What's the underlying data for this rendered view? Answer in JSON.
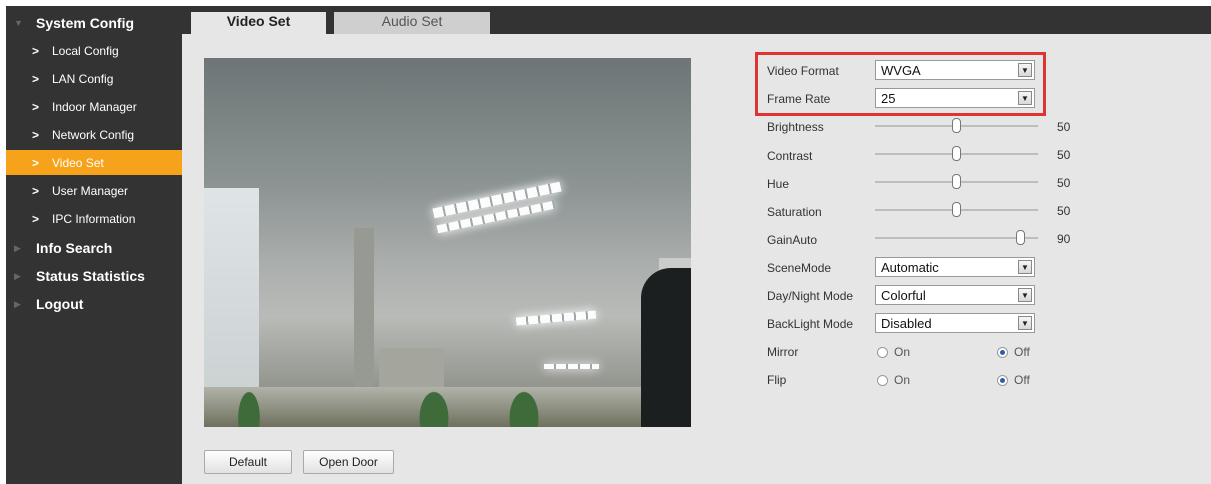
{
  "sidebar": {
    "sections": [
      {
        "label": "System Config"
      },
      {
        "label": "Info Search"
      },
      {
        "label": "Status Statistics"
      },
      {
        "label": "Logout"
      }
    ],
    "items": [
      {
        "label": "Local Config"
      },
      {
        "label": "LAN Config"
      },
      {
        "label": "Indoor Manager"
      },
      {
        "label": "Network Config"
      },
      {
        "label": "Video Set",
        "active": true
      },
      {
        "label": "User Manager"
      },
      {
        "label": "IPC Information"
      }
    ]
  },
  "tabs": [
    {
      "label": "Video Set",
      "active": true
    },
    {
      "label": "Audio Set",
      "active": false
    }
  ],
  "settings": {
    "video_format": {
      "label": "Video Format",
      "value": "WVGA"
    },
    "frame_rate": {
      "label": "Frame Rate",
      "value": "25"
    },
    "brightness": {
      "label": "Brightness",
      "value": "50"
    },
    "contrast": {
      "label": "Contrast",
      "value": "50"
    },
    "hue": {
      "label": "Hue",
      "value": "50"
    },
    "saturation": {
      "label": "Saturation",
      "value": "50"
    },
    "gain_auto": {
      "label": "GainAuto",
      "value": "90"
    },
    "scene_mode": {
      "label": "SceneMode",
      "value": "Automatic"
    },
    "day_night_mode": {
      "label": "Day/Night Mode",
      "value": "Colorful"
    },
    "backlight_mode": {
      "label": "BackLight Mode",
      "value": "Disabled"
    },
    "mirror": {
      "label": "Mirror",
      "on_label": "On",
      "off_label": "Off",
      "selected": "Off"
    },
    "flip": {
      "label": "Flip",
      "on_label": "On",
      "off_label": "Off",
      "selected": "Off"
    }
  },
  "buttons": {
    "default_label": "Default",
    "open_door_label": "Open Door"
  },
  "colors": {
    "sidebar_bg": "#333333",
    "active_accent": "#f7a21b",
    "panel_bg": "#e6e6e6",
    "highlight_border": "#e03333"
  }
}
